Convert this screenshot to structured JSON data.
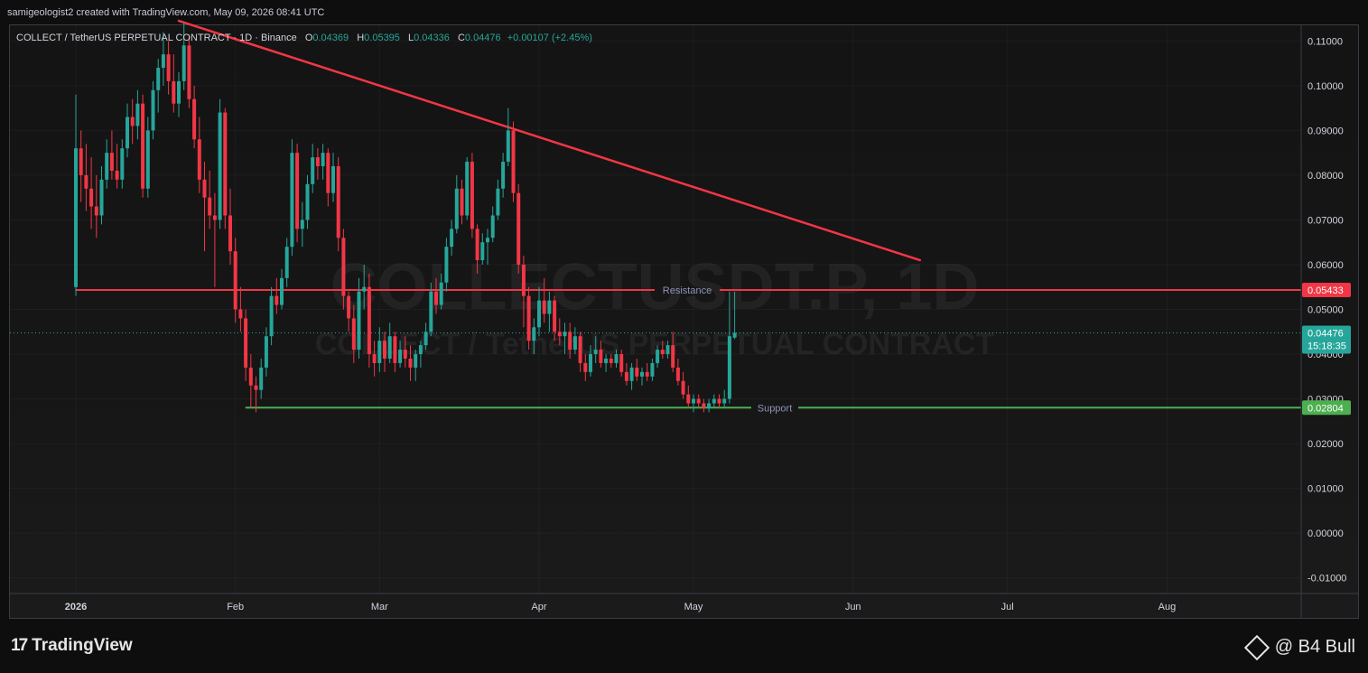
{
  "header": {
    "credit": "samigeologist2 created with TradingView.com, May 09, 2026 08:41 UTC"
  },
  "legend": {
    "symbol": "COLLECT / TetherUS PERPETUAL CONTRACT · 1D · Binance",
    "o_label": "O",
    "o": "0.04369",
    "h_label": "H",
    "h": "0.05395",
    "l_label": "L",
    "l": "0.04336",
    "c_label": "C",
    "c": "0.04476",
    "change": "+0.00107 (+2.45%)"
  },
  "watermark": {
    "line1": "COLLECTUSDT.P, 1D",
    "line2": "COLLECT / TetherUS PERPETUAL CONTRACT"
  },
  "footer": {
    "brand": "TradingView",
    "author": "@ B4 Bull"
  },
  "colors": {
    "up": "#26a69a",
    "down": "#f23645",
    "resistance": "#f23645",
    "trend": "#f23645",
    "support": "#4caf50",
    "axis_text": "#d1d4dc"
  },
  "chart_data": {
    "type": "candlestick",
    "y_ticks": [
      "0.11000",
      "0.10000",
      "0.09000",
      "0.08000",
      "0.07000",
      "0.06000",
      "0.05000",
      "0.04000",
      "0.03000",
      "0.02000",
      "0.01000",
      "0.00000",
      "-0.01000"
    ],
    "ylim": [
      -0.0135,
      0.1135
    ],
    "x_ticks": [
      {
        "label": "2026",
        "date": "2026-01-01"
      },
      {
        "label": "Feb",
        "date": "2026-02-01"
      },
      {
        "label": "Mar",
        "date": "2026-03-01"
      },
      {
        "label": "Apr",
        "date": "2026-04-01"
      },
      {
        "label": "May",
        "date": "2026-05-01"
      },
      {
        "label": "Jun",
        "date": "2026-06-01"
      },
      {
        "label": "Jul",
        "date": "2026-07-01"
      },
      {
        "label": "Aug",
        "date": "2026-08-01"
      }
    ],
    "levels": {
      "resistance": {
        "label": "Resistance",
        "value": 0.05433,
        "tag": "0.05433",
        "from": "2026-01-01",
        "to": "2026-09-10"
      },
      "support": {
        "label": "Support",
        "value": 0.02804,
        "tag": "0.02804",
        "from": "2026-02-04",
        "to": "2026-09-10"
      },
      "last_price": {
        "value": 0.04476,
        "tag": "0.04476",
        "countdown": "15:18:35"
      }
    },
    "trendline": {
      "start": {
        "date": "2026-01-21",
        "value": 0.1145
      },
      "end": {
        "date": "2026-06-14",
        "value": 0.061
      }
    },
    "candles_ohlc": [
      [
        "2026-01-01",
        0.055,
        0.098,
        0.053,
        0.086
      ],
      [
        "2026-01-02",
        0.086,
        0.09,
        0.074,
        0.08
      ],
      [
        "2026-01-03",
        0.08,
        0.087,
        0.072,
        0.077
      ],
      [
        "2026-01-04",
        0.077,
        0.084,
        0.068,
        0.073
      ],
      [
        "2026-01-05",
        0.073,
        0.08,
        0.066,
        0.071
      ],
      [
        "2026-01-06",
        0.071,
        0.082,
        0.069,
        0.079
      ],
      [
        "2026-01-07",
        0.079,
        0.088,
        0.077,
        0.085
      ],
      [
        "2026-01-08",
        0.085,
        0.09,
        0.079,
        0.081
      ],
      [
        "2026-01-09",
        0.081,
        0.087,
        0.077,
        0.079
      ],
      [
        "2026-01-10",
        0.079,
        0.088,
        0.077,
        0.086
      ],
      [
        "2026-01-11",
        0.086,
        0.096,
        0.084,
        0.093
      ],
      [
        "2026-01-12",
        0.093,
        0.097,
        0.087,
        0.091
      ],
      [
        "2026-01-13",
        0.091,
        0.099,
        0.088,
        0.096
      ],
      [
        "2026-01-14",
        0.096,
        0.098,
        0.075,
        0.077
      ],
      [
        "2026-01-15",
        0.077,
        0.093,
        0.075,
        0.09
      ],
      [
        "2026-01-16",
        0.09,
        0.101,
        0.088,
        0.099
      ],
      [
        "2026-01-17",
        0.099,
        0.106,
        0.094,
        0.104
      ],
      [
        "2026-01-18",
        0.104,
        0.112,
        0.1,
        0.107
      ],
      [
        "2026-01-19",
        0.107,
        0.11,
        0.098,
        0.101
      ],
      [
        "2026-01-20",
        0.101,
        0.107,
        0.094,
        0.096
      ],
      [
        "2026-01-21",
        0.096,
        0.103,
        0.093,
        0.101
      ],
      [
        "2026-01-22",
        0.101,
        0.114,
        0.099,
        0.109
      ],
      [
        "2026-01-23",
        0.109,
        0.111,
        0.095,
        0.097
      ],
      [
        "2026-01-24",
        0.097,
        0.1,
        0.086,
        0.088
      ],
      [
        "2026-01-25",
        0.088,
        0.093,
        0.076,
        0.079
      ],
      [
        "2026-01-26",
        0.079,
        0.083,
        0.063,
        0.075
      ],
      [
        "2026-01-27",
        0.075,
        0.081,
        0.068,
        0.071
      ],
      [
        "2026-01-28",
        0.071,
        0.076,
        0.055,
        0.07
      ],
      [
        "2026-01-29",
        0.07,
        0.097,
        0.068,
        0.094
      ],
      [
        "2026-01-30",
        0.094,
        0.095,
        0.068,
        0.071
      ],
      [
        "2026-01-31",
        0.071,
        0.077,
        0.06,
        0.063
      ],
      [
        "2026-02-01",
        0.063,
        0.066,
        0.047,
        0.05
      ],
      [
        "2026-02-02",
        0.05,
        0.055,
        0.045,
        0.048
      ],
      [
        "2026-02-03",
        0.048,
        0.05,
        0.034,
        0.037
      ],
      [
        "2026-02-04",
        0.037,
        0.04,
        0.028,
        0.033
      ],
      [
        "2026-02-05",
        0.033,
        0.035,
        0.027,
        0.032
      ],
      [
        "2026-02-06",
        0.032,
        0.039,
        0.03,
        0.037
      ],
      [
        "2026-02-07",
        0.037,
        0.046,
        0.035,
        0.044
      ],
      [
        "2026-02-08",
        0.044,
        0.055,
        0.042,
        0.053
      ],
      [
        "2026-02-09",
        0.053,
        0.057,
        0.049,
        0.051
      ],
      [
        "2026-02-10",
        0.051,
        0.059,
        0.05,
        0.057
      ],
      [
        "2026-02-11",
        0.057,
        0.066,
        0.055,
        0.064
      ],
      [
        "2026-02-12",
        0.064,
        0.088,
        0.062,
        0.085
      ],
      [
        "2026-02-13",
        0.085,
        0.087,
        0.065,
        0.068
      ],
      [
        "2026-02-14",
        0.068,
        0.074,
        0.064,
        0.07
      ],
      [
        "2026-02-15",
        0.07,
        0.08,
        0.068,
        0.078
      ],
      [
        "2026-02-16",
        0.078,
        0.087,
        0.076,
        0.084
      ],
      [
        "2026-02-17",
        0.084,
        0.086,
        0.079,
        0.082
      ],
      [
        "2026-02-18",
        0.082,
        0.087,
        0.079,
        0.085
      ],
      [
        "2026-02-19",
        0.085,
        0.086,
        0.073,
        0.076
      ],
      [
        "2026-02-20",
        0.076,
        0.085,
        0.074,
        0.082
      ],
      [
        "2026-02-21",
        0.082,
        0.084,
        0.063,
        0.066
      ],
      [
        "2026-02-22",
        0.066,
        0.068,
        0.05,
        0.053
      ],
      [
        "2026-02-23",
        0.053,
        0.054,
        0.045,
        0.048
      ],
      [
        "2026-02-24",
        0.048,
        0.051,
        0.038,
        0.041
      ],
      [
        "2026-02-25",
        0.041,
        0.057,
        0.039,
        0.054
      ],
      [
        "2026-02-26",
        0.054,
        0.06,
        0.05,
        0.055
      ],
      [
        "2026-02-27",
        0.055,
        0.058,
        0.037,
        0.04
      ],
      [
        "2026-02-28",
        0.04,
        0.043,
        0.035,
        0.038
      ],
      [
        "2026-03-01",
        0.038,
        0.046,
        0.036,
        0.043
      ],
      [
        "2026-03-02",
        0.043,
        0.045,
        0.036,
        0.039
      ],
      [
        "2026-03-03",
        0.039,
        0.047,
        0.038,
        0.044
      ],
      [
        "2026-03-04",
        0.044,
        0.045,
        0.036,
        0.038
      ],
      [
        "2026-03-05",
        0.038,
        0.043,
        0.037,
        0.041
      ],
      [
        "2026-03-06",
        0.041,
        0.044,
        0.037,
        0.039
      ],
      [
        "2026-03-07",
        0.039,
        0.042,
        0.034,
        0.037
      ],
      [
        "2026-03-08",
        0.037,
        0.041,
        0.034,
        0.04
      ],
      [
        "2026-03-09",
        0.04,
        0.043,
        0.037,
        0.042
      ],
      [
        "2026-03-10",
        0.042,
        0.047,
        0.041,
        0.045
      ],
      [
        "2026-03-11",
        0.045,
        0.056,
        0.044,
        0.054
      ],
      [
        "2026-03-12",
        0.054,
        0.057,
        0.049,
        0.051
      ],
      [
        "2026-03-13",
        0.051,
        0.058,
        0.05,
        0.056
      ],
      [
        "2026-03-14",
        0.056,
        0.066,
        0.054,
        0.064
      ],
      [
        "2026-03-15",
        0.064,
        0.07,
        0.062,
        0.068
      ],
      [
        "2026-03-16",
        0.068,
        0.08,
        0.067,
        0.077
      ],
      [
        "2026-03-17",
        0.077,
        0.079,
        0.069,
        0.071
      ],
      [
        "2026-03-18",
        0.071,
        0.084,
        0.07,
        0.083
      ],
      [
        "2026-03-19",
        0.083,
        0.085,
        0.066,
        0.068
      ],
      [
        "2026-03-20",
        0.068,
        0.069,
        0.058,
        0.061
      ],
      [
        "2026-03-21",
        0.061,
        0.067,
        0.06,
        0.065
      ],
      [
        "2026-03-22",
        0.065,
        0.068,
        0.06,
        0.066
      ],
      [
        "2026-03-23",
        0.066,
        0.073,
        0.065,
        0.071
      ],
      [
        "2026-03-24",
        0.071,
        0.079,
        0.07,
        0.077
      ],
      [
        "2026-03-25",
        0.077,
        0.085,
        0.075,
        0.083
      ],
      [
        "2026-03-26",
        0.083,
        0.095,
        0.082,
        0.09
      ],
      [
        "2026-03-27",
        0.09,
        0.092,
        0.074,
        0.076
      ],
      [
        "2026-03-28",
        0.076,
        0.078,
        0.058,
        0.06
      ],
      [
        "2026-03-29",
        0.06,
        0.062,
        0.046,
        0.053
      ],
      [
        "2026-03-30",
        0.053,
        0.055,
        0.041,
        0.043
      ],
      [
        "2026-03-31",
        0.043,
        0.048,
        0.04,
        0.046
      ],
      [
        "2026-04-01",
        0.046,
        0.055,
        0.044,
        0.052
      ],
      [
        "2026-04-02",
        0.052,
        0.057,
        0.047,
        0.049
      ],
      [
        "2026-04-03",
        0.049,
        0.054,
        0.045,
        0.052
      ],
      [
        "2026-04-04",
        0.052,
        0.053,
        0.043,
        0.045
      ],
      [
        "2026-04-05",
        0.045,
        0.048,
        0.042,
        0.044
      ],
      [
        "2026-04-06",
        0.044,
        0.047,
        0.04,
        0.045
      ],
      [
        "2026-04-07",
        0.045,
        0.047,
        0.039,
        0.041
      ],
      [
        "2026-04-08",
        0.041,
        0.046,
        0.04,
        0.044
      ],
      [
        "2026-04-09",
        0.044,
        0.045,
        0.036,
        0.038
      ],
      [
        "2026-04-10",
        0.038,
        0.04,
        0.034,
        0.036
      ],
      [
        "2026-04-11",
        0.036,
        0.042,
        0.035,
        0.04
      ],
      [
        "2026-04-12",
        0.04,
        0.044,
        0.038,
        0.041
      ],
      [
        "2026-04-13",
        0.041,
        0.043,
        0.037,
        0.038
      ],
      [
        "2026-04-14",
        0.038,
        0.04,
        0.036,
        0.039
      ],
      [
        "2026-04-15",
        0.039,
        0.04,
        0.037,
        0.038
      ],
      [
        "2026-04-16",
        0.038,
        0.041,
        0.037,
        0.04
      ],
      [
        "2026-04-17",
        0.04,
        0.041,
        0.035,
        0.036
      ],
      [
        "2026-04-18",
        0.036,
        0.038,
        0.033,
        0.034
      ],
      [
        "2026-04-19",
        0.034,
        0.038,
        0.032,
        0.037
      ],
      [
        "2026-04-20",
        0.037,
        0.039,
        0.034,
        0.035
      ],
      [
        "2026-04-21",
        0.035,
        0.037,
        0.033,
        0.036
      ],
      [
        "2026-04-22",
        0.036,
        0.038,
        0.034,
        0.035
      ],
      [
        "2026-04-23",
        0.035,
        0.039,
        0.034,
        0.038
      ],
      [
        "2026-04-24",
        0.038,
        0.042,
        0.037,
        0.041
      ],
      [
        "2026-04-25",
        0.041,
        0.043,
        0.039,
        0.04
      ],
      [
        "2026-04-26",
        0.04,
        0.043,
        0.039,
        0.042
      ],
      [
        "2026-04-27",
        0.042,
        0.045,
        0.036,
        0.037
      ],
      [
        "2026-04-28",
        0.037,
        0.039,
        0.033,
        0.034
      ],
      [
        "2026-04-29",
        0.034,
        0.036,
        0.03,
        0.031
      ],
      [
        "2026-04-30",
        0.031,
        0.033,
        0.028,
        0.029
      ],
      [
        "2026-05-01",
        0.029,
        0.031,
        0.027,
        0.03
      ],
      [
        "2026-05-02",
        0.03,
        0.031,
        0.028,
        0.029
      ],
      [
        "2026-05-03",
        0.029,
        0.03,
        0.027,
        0.028
      ],
      [
        "2026-05-04",
        0.028,
        0.03,
        0.027,
        0.029
      ],
      [
        "2026-05-05",
        0.029,
        0.031,
        0.028,
        0.03
      ],
      [
        "2026-05-06",
        0.03,
        0.031,
        0.028,
        0.029
      ],
      [
        "2026-05-07",
        0.029,
        0.032,
        0.028,
        0.03
      ],
      [
        "2026-05-08",
        0.03,
        0.054,
        0.029,
        0.044
      ],
      [
        "2026-05-09",
        0.04369,
        0.05395,
        0.04336,
        0.04476
      ]
    ]
  }
}
